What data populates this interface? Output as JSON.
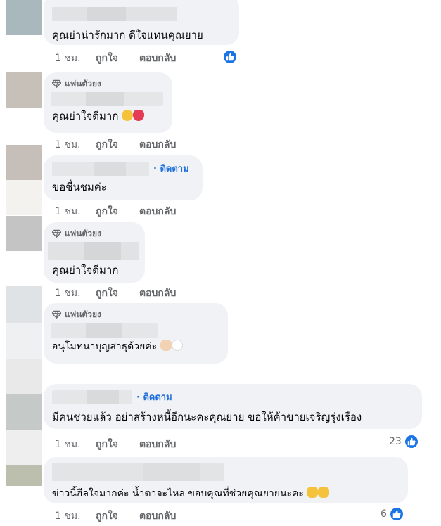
{
  "comments": [
    {
      "badge": "",
      "text": "คุณย่าน่ารักมาก ดีใจแทนคุณยาย",
      "follow": "",
      "time": "1 ชม.",
      "like": "ถูกใจ",
      "reply": "ตอบกลับ",
      "reaction_count": ""
    },
    {
      "badge": "แฟนตัวยง",
      "text": "คุณย่าใจดีมาก",
      "follow": "",
      "time": "1 ชม.",
      "like": "ถูกใจ",
      "reply": "ตอบกลับ",
      "reaction_count": ""
    },
    {
      "badge": "",
      "text": "ขอชื่นชมค่ะ",
      "follow": "· ติดตาม",
      "time": "1 ชม.",
      "like": "ถูกใจ",
      "reply": "ตอบกลับ",
      "reaction_count": ""
    },
    {
      "badge": "แฟนตัวยง",
      "text": "คุณย่าใจดีมาก",
      "follow": "",
      "time": "1 ชม.",
      "like": "ถูกใจ",
      "reply": "ตอบกลับ",
      "reaction_count": ""
    },
    {
      "badge": "แฟนตัวยง",
      "text": "อนุโมทนาบุญสาธุด้วยค่ะ",
      "follow": "",
      "time": "",
      "like": "",
      "reply": "",
      "reaction_count": ""
    },
    {
      "badge": "",
      "text": "มีคนช่วยแล้ว อย่าสร้างหนี้อีกนะคะคุณยาย ขอให้ค้าขายเจริญรุ่งเรือง",
      "follow": "· ติดตาม",
      "time": "1 ชม.",
      "like": "ถูกใจ",
      "reply": "ตอบกลับ",
      "reaction_count": "23"
    },
    {
      "badge": "",
      "text": "ข่าวนี้ฮีลใจมากค่ะ น้ำตาจะไหล ขอบคุณที่ช่วยคุณยายนะคะ",
      "follow": "",
      "time": "1 ชม.",
      "like": "ถูกใจ",
      "reply": "ตอบกลับ",
      "reaction_count": "6"
    }
  ],
  "colors": {
    "bubble": "#f0f2f5",
    "link": "#216fdb",
    "like_blue": "#1b74e4",
    "meta_text": "#65676b"
  },
  "icons": [
    "diamond-icon",
    "like-thumb-icon",
    "emoji-icons"
  ]
}
